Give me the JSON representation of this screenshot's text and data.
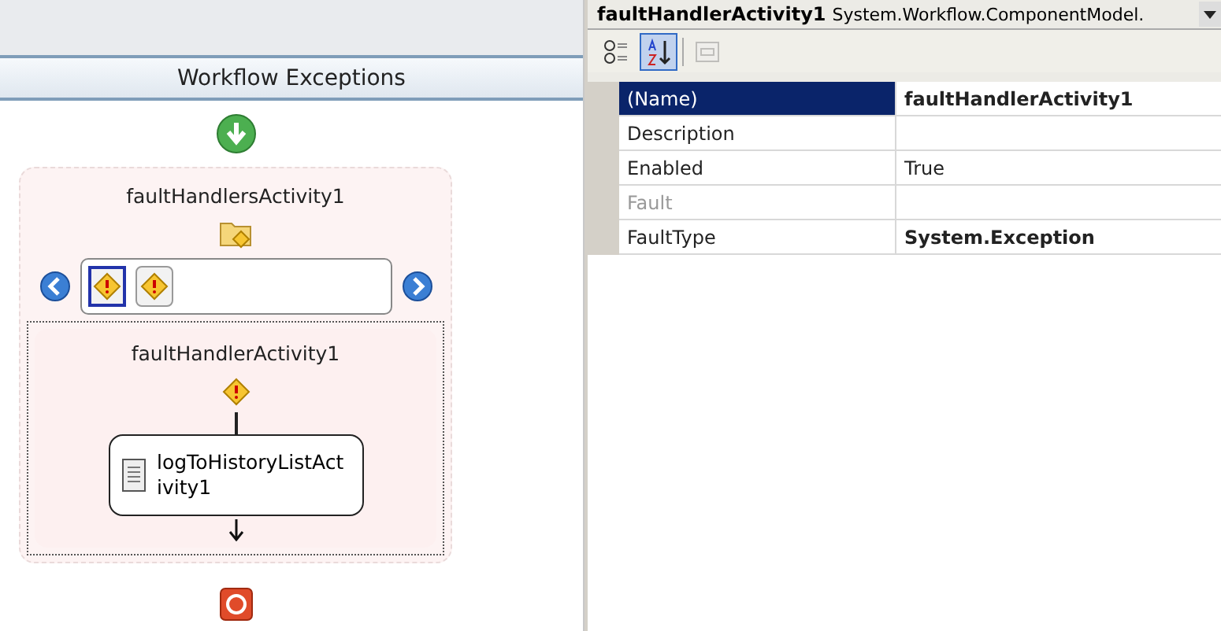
{
  "designer": {
    "header": "Workflow Exceptions",
    "fault_handlers": {
      "title": "faultHandlersActivity1",
      "handlers": [
        {
          "selected": true
        },
        {
          "selected": false
        }
      ],
      "handler": {
        "title": "faultHandlerActivity1",
        "activity": {
          "name": "logToHistoryListActivity1"
        }
      }
    }
  },
  "properties": {
    "object": {
      "name": "faultHandlerActivity1",
      "type": "System.Workflow.ComponentModel."
    },
    "toolbar": [
      {
        "kind": "categorized",
        "selected": false,
        "disabled": false
      },
      {
        "kind": "alphabetical",
        "selected": true,
        "disabled": false
      },
      {
        "kind": "pages",
        "selected": false,
        "disabled": true
      }
    ],
    "rows": [
      {
        "name": "(Name)",
        "value": "faultHandlerActivity1",
        "selected": true,
        "disabled": false,
        "modified": true
      },
      {
        "name": "Description",
        "selected": false,
        "disabled": false
      },
      {
        "name": "Enabled",
        "value": "True",
        "selected": false,
        "disabled": false,
        "modified": false
      },
      {
        "name": "Fault",
        "selected": false,
        "disabled": true
      },
      {
        "name": "FaultType",
        "value": "System.Exception",
        "selected": false,
        "disabled": false,
        "modified": true
      }
    ]
  }
}
